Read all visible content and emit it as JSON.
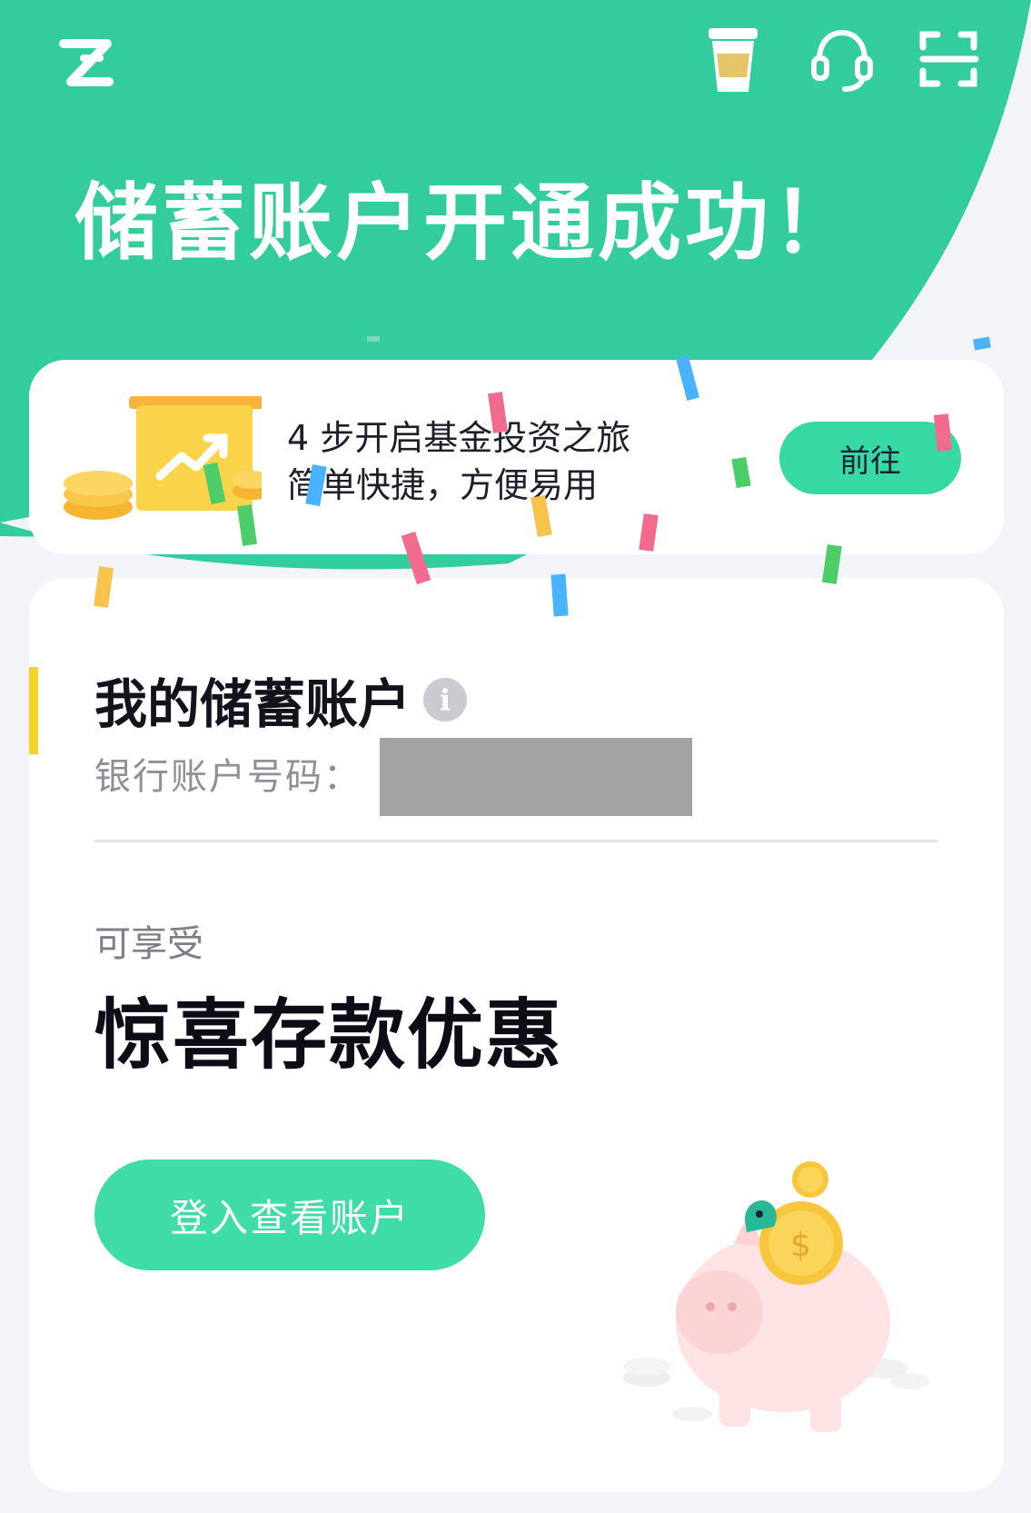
{
  "header": {
    "title": "储蓄账户开通成功！",
    "icons": [
      "zeta-logo-icon",
      "coffee-cup-icon",
      "headset-icon",
      "scan-icon"
    ]
  },
  "promo": {
    "line1": "4 步开启基金投资之旅",
    "line2": "简单快捷，方便易用",
    "button_label": "前往",
    "illustration": "fund-chart-coins-icon"
  },
  "account": {
    "title": "我的储蓄账户",
    "info_glyph": "i",
    "number_label": "银行账户号码：",
    "enjoy_label": "可享受",
    "offer_title": "惊喜存款优惠",
    "login_button_label": "登入查看账户",
    "illustration": "piggy-bank-icon"
  },
  "colors": {
    "brand_green": "#33cc9d",
    "button_green": "#3fdca9",
    "accent_yellow": "#f5d227"
  }
}
